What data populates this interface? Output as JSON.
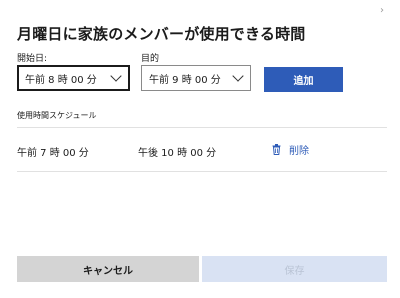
{
  "dialog": {
    "title": "月曜日に家族のメンバーが使用できる時間",
    "close_icon": "›"
  },
  "form": {
    "start_label": "開始日:",
    "end_label": "目的",
    "start_value": "午前 8 時 00 分",
    "end_value": "午前 9 時 00 分",
    "add_label": "追加"
  },
  "schedule": {
    "header": "使用時間スケジュール",
    "rows": [
      {
        "start": "午前 7 時 00 分",
        "end": "午後 10 時 00 分",
        "delete_label": "削除",
        "delete_icon": "trash-icon"
      }
    ]
  },
  "footer": {
    "cancel_label": "キャンセル",
    "save_label": "保存",
    "save_enabled": false
  },
  "colors": {
    "accent": "#2e5cb8",
    "cancel_bg": "#d4d4d4",
    "save_disabled_bg": "#d9e2f3",
    "divider": "#e1e1e1"
  }
}
